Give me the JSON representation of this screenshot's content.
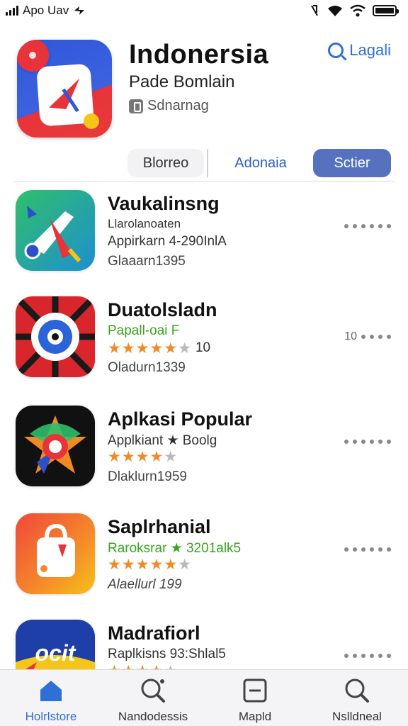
{
  "status_bar": {
    "carrier": "Apo Uav",
    "battery_level": 1.0
  },
  "header": {
    "title": "Indonersia",
    "subtitle": "Pade Bomlain",
    "category": "Sdnarnag",
    "search_label": "Lagali",
    "search_icon": "search-icon"
  },
  "segments": {
    "items": [
      {
        "label": "Blorreo"
      },
      {
        "label": "Adonaia"
      },
      {
        "label": "Sctier"
      }
    ],
    "selected": 2,
    "accent": "#5672bf"
  },
  "apps": [
    {
      "title": "Vaukalinsng",
      "line2": "Llarolanoaten",
      "line3": "Appirkarn 4-290InlA",
      "line4": "Glaaarn1395",
      "rating": null,
      "more_label": ""
    },
    {
      "title": "Duatolsladn",
      "line2": "Papall-oai F",
      "line3": "10",
      "line4": "Oladurn1339",
      "rating": 5,
      "more_label": "10"
    },
    {
      "title": "Aplkasi Popular",
      "line2": "Applkiant ★ Boolg",
      "line3": "",
      "line4": "Dlaklurn1959",
      "rating": 4,
      "more_label": ""
    },
    {
      "title": "Saplrhanial",
      "line2": "Raroksrar ★ 3201alk5",
      "line3": "",
      "line4": "Alaellurl 199",
      "rating": 5,
      "more_label": ""
    },
    {
      "title": "Madrafiorl",
      "line2": "Raplkisns 93:Shlal5",
      "line3": "",
      "line4": "",
      "rating": 4,
      "more_label": ""
    }
  ],
  "tab_bar": {
    "tabs": [
      {
        "label": "Holrlstore",
        "icon": "home-icon"
      },
      {
        "label": "Nandodessis",
        "icon": "search-icon"
      },
      {
        "label": "Mapld",
        "icon": "minus-box-icon"
      },
      {
        "label": "Nslldneal",
        "icon": "search-icon"
      }
    ],
    "active": 0,
    "accent": "#2f6fd6"
  },
  "colors": {
    "star": "#f08a24",
    "link": "#2f6fd6",
    "green_text": "#38a51c"
  }
}
